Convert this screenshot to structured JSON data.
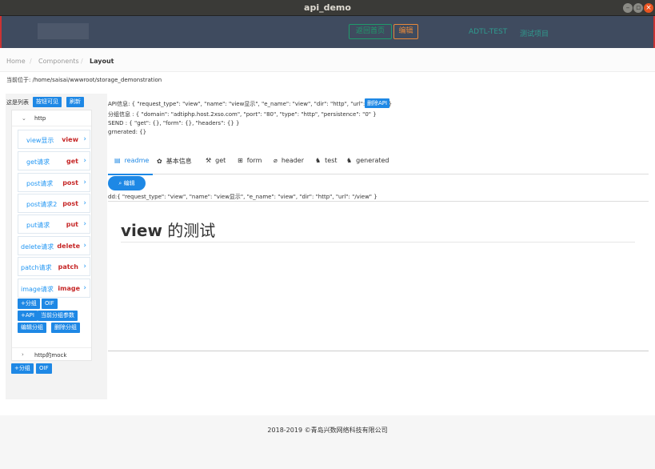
{
  "window": {
    "title": "api_demo"
  },
  "navbar": {
    "back_label": "返回首页",
    "edit_label": "编辑",
    "link1": "ADTL-TEST",
    "link2": "测试项目"
  },
  "breadcrumb": {
    "home": "Home",
    "components": "Components",
    "layout": "Layout",
    "sep": "/"
  },
  "location": "当前位于: /home/saisai/wwwroot/storage_demonstration",
  "sidebar": {
    "list_label": "这是列表",
    "visible_btn": "按钮可见",
    "refresh_btn": "刷新",
    "group1": "http",
    "items": [
      {
        "name": "view显示",
        "method": "view"
      },
      {
        "name": "get请求",
        "method": "get"
      },
      {
        "name": "post请求",
        "method": "post"
      },
      {
        "name": "post请求2",
        "method": "post"
      },
      {
        "name": "put请求",
        "method": "put"
      },
      {
        "name": "delete请求",
        "method": "delete"
      },
      {
        "name": "patch请求",
        "method": "patch"
      },
      {
        "name": "image请求",
        "method": "image"
      }
    ],
    "add_group": "+分组",
    "oif": "OIF",
    "add_api": "+API",
    "group_params": "当前分组参数",
    "edit_group": "编辑分组",
    "delete_group": "删除分组",
    "group2": "http的mock",
    "add_group2": "+分组",
    "oif2": "OIF"
  },
  "info": {
    "api_line": "API信息: { \"request_type\": \"view\", \"name\": \"view显示\", \"e_name\": \"view\", \"dir\": \"http\", \"url\": \"/view\" }",
    "delete_api": "删除API",
    "group_line": "分组信息 : { \"domain\": \"adtiphp.host.2xso.com\", \"port\": \"80\", \"type\": \"http\", \"persistence\": \"0\" }",
    "send_line": "SEND : { \"get\": {}, \"form\": {}, \"headers\": {} }",
    "generated_line": "grnerated: {}"
  },
  "tabs": [
    {
      "label": "readme",
      "icon": "doc-icon"
    },
    {
      "label": "基本信息",
      "icon": "info-icon"
    },
    {
      "label": "get",
      "icon": "tools-icon"
    },
    {
      "label": "form",
      "icon": "grid-icon"
    },
    {
      "label": "header",
      "icon": "attach-icon"
    },
    {
      "label": "test",
      "icon": "cat-icon"
    },
    {
      "label": "generated",
      "icon": "cat-icon"
    }
  ],
  "edit_button": "编辑",
  "dd_line": "dd:{ \"request_type\": \"view\", \"name\": \"view显示\", \"e_name\": \"view\", \"dir\": \"http\", \"url\": \"/view\" }",
  "doc": {
    "title_bold": "view",
    "title_rest": " 的测试"
  },
  "footer": "2018-2019 ©青岛兴数网络科技有限公司",
  "colors": {
    "accent": "#1e88e5",
    "navbar": "#3f4b5f",
    "method": "#c62828"
  }
}
